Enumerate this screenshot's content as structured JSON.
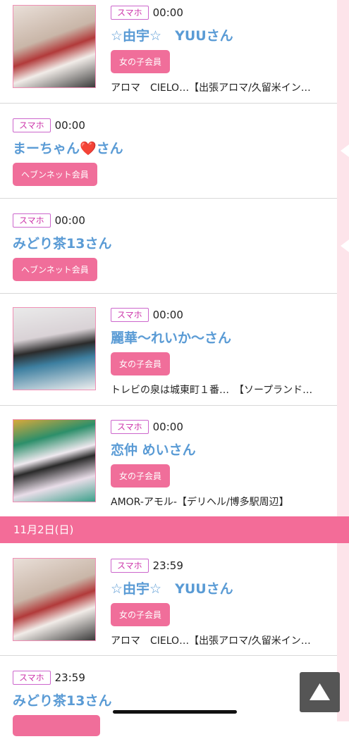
{
  "items": [
    {
      "badge": "スマホ",
      "time": "00:00",
      "name": "☆由宇☆　YUUさん",
      "member": "女の子会員",
      "shop": "アロマ　CIELO…【出張アロマ/久留米イン…"
    },
    {
      "badge": "スマホ",
      "time": "00:00",
      "name": "まーちゃん❤️さん",
      "member": "ヘブンネット会員"
    },
    {
      "badge": "スマホ",
      "time": "00:00",
      "name": "みどり茶13さん",
      "member": "ヘブンネット会員"
    },
    {
      "badge": "スマホ",
      "time": "00:00",
      "name": "麗華〜れいか〜さん",
      "member": "女の子会員",
      "shop": "トレビの泉は城東町１番…　【ソープランド…"
    },
    {
      "badge": "スマホ",
      "time": "00:00",
      "name": "恋仲 めいさん",
      "member": "女の子会員",
      "shop": "AMOR-アモル-【デリヘル/博多駅周辺】"
    },
    {
      "badge": "スマホ",
      "time": "23:59",
      "name": "☆由宇☆　YUUさん",
      "member": "女の子会員",
      "shop": "アロマ　CIELO…【出張アロマ/久留米イン…"
    },
    {
      "badge": "スマホ",
      "time": "23:59",
      "name": "みどり茶13さん"
    }
  ],
  "date_header": "11月2日(日)",
  "colors": {
    "accent": "#f36c98",
    "name": "#5a9bd5",
    "badge_border": "#cc66cc"
  },
  "icons": {
    "scroll_top": "triangle-up-icon"
  }
}
